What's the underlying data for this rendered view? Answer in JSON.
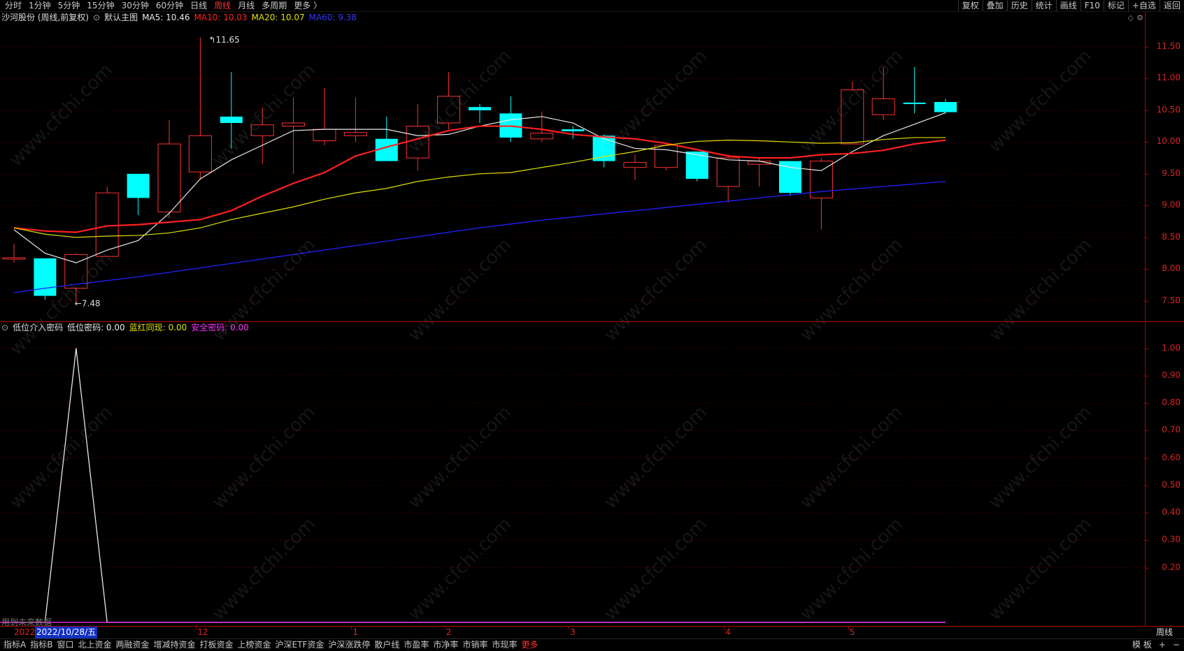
{
  "toolbar": {
    "periods": [
      "分时",
      "1分钟",
      "5分钟",
      "15分钟",
      "30分钟",
      "60分钟",
      "日线",
      "周线",
      "月线",
      "多周期",
      "更多 〉"
    ],
    "active_period": "周线",
    "right_buttons": [
      "复权",
      "叠加",
      "历史",
      "统计",
      "画线",
      "F10",
      "标记",
      "+自选",
      "返回"
    ]
  },
  "main": {
    "stock_name": "沙河股份 (周线,前复权)",
    "template": "默认主图",
    "ma5": "MA5: 10.46",
    "ma10": "MA10: 10.03",
    "ma20": "MA20: 10.07",
    "ma60": "MA60: 9.38",
    "high_label": "11.65",
    "low_label": "7.48",
    "axis_ticks": [
      "11.50",
      "11.00",
      "10.50",
      "10.00",
      "9.50",
      "9.00",
      "8.50",
      "8.00",
      "7.50"
    ]
  },
  "indicator": {
    "name": "低位介入密码",
    "v1": "低位密码: 0.00",
    "v2": "蓝红同现: 0.00",
    "v3": "安全密码: 0.00",
    "axis_ticks": [
      "1.00",
      "0.90",
      "0.80",
      "0.70",
      "0.60",
      "0.50",
      "0.40",
      "0.30",
      "0.20"
    ],
    "future_note": "用到未来数据"
  },
  "time_axis": {
    "year_marker": "2022",
    "cursor_date": "2022/10/28/五",
    "months": [
      "12",
      "1",
      "2",
      "3",
      "4",
      "5"
    ],
    "period_label": "周线"
  },
  "bottom": {
    "buttons": [
      "指标A",
      "指标B",
      "窗口",
      "北上资金",
      "两融资金",
      "增减持资金",
      "打板资金",
      "上榜资金",
      "沪深ETF资金",
      "沪深涨跌停",
      "散户线",
      "市盈率",
      "市净率",
      "市销率",
      "市现率",
      "更多"
    ],
    "right": [
      "模 板",
      "+",
      "−"
    ]
  },
  "watermark": "www.cfchi.com",
  "colors": {
    "up": "#ff3232",
    "down": "#00ffff",
    "ma5": "#e8e8e8",
    "ma10": "#ff2020",
    "ma20": "#e0e000",
    "ma60": "#2020ff"
  },
  "chart_data": {
    "type": "candlestick",
    "candles": [
      {
        "o": 8.18,
        "h": 8.4,
        "l": 8.1,
        "c": 8.18
      },
      {
        "o": 8.17,
        "h": 8.17,
        "l": 7.52,
        "c": 7.58
      },
      {
        "o": 7.7,
        "h": 8.25,
        "l": 7.48,
        "c": 8.23
      },
      {
        "o": 8.2,
        "h": 9.3,
        "l": 8.2,
        "c": 9.2
      },
      {
        "o": 9.5,
        "h": 9.5,
        "l": 8.85,
        "c": 9.12
      },
      {
        "o": 8.9,
        "h": 10.35,
        "l": 8.8,
        "c": 9.97
      },
      {
        "o": 9.53,
        "h": 11.65,
        "l": 9.4,
        "c": 10.1
      },
      {
        "o": 10.4,
        "h": 11.1,
        "l": 9.9,
        "c": 10.3
      },
      {
        "o": 10.1,
        "h": 10.55,
        "l": 9.65,
        "c": 10.27
      },
      {
        "o": 10.25,
        "h": 10.7,
        "l": 9.5,
        "c": 10.3
      },
      {
        "o": 10.02,
        "h": 10.85,
        "l": 9.95,
        "c": 10.2
      },
      {
        "o": 10.1,
        "h": 10.7,
        "l": 10.0,
        "c": 10.15
      },
      {
        "o": 10.05,
        "h": 10.4,
        "l": 9.8,
        "c": 9.7
      },
      {
        "o": 9.75,
        "h": 10.6,
        "l": 9.55,
        "c": 10.25
      },
      {
        "o": 10.3,
        "h": 11.1,
        "l": 10.2,
        "c": 10.72
      },
      {
        "o": 10.55,
        "h": 10.6,
        "l": 10.3,
        "c": 10.5
      },
      {
        "o": 10.45,
        "h": 10.72,
        "l": 10.0,
        "c": 10.07
      },
      {
        "o": 10.05,
        "h": 10.48,
        "l": 10.0,
        "c": 10.14
      },
      {
        "o": 10.2,
        "h": 10.25,
        "l": 10.05,
        "c": 10.17
      },
      {
        "o": 10.1,
        "h": 10.12,
        "l": 9.6,
        "c": 9.7
      },
      {
        "o": 9.6,
        "h": 9.8,
        "l": 9.4,
        "c": 9.68
      },
      {
        "o": 9.6,
        "h": 9.98,
        "l": 9.55,
        "c": 9.95
      },
      {
        "o": 9.85,
        "h": 9.85,
        "l": 9.38,
        "c": 9.42
      },
      {
        "o": 9.3,
        "h": 9.8,
        "l": 9.05,
        "c": 9.75
      },
      {
        "o": 9.65,
        "h": 9.75,
        "l": 9.3,
        "c": 9.7
      },
      {
        "o": 9.7,
        "h": 9.7,
        "l": 9.15,
        "c": 9.2
      },
      {
        "o": 9.12,
        "h": 9.75,
        "l": 8.62,
        "c": 9.7
      },
      {
        "o": 9.97,
        "h": 10.95,
        "l": 9.97,
        "c": 10.82
      },
      {
        "o": 10.43,
        "h": 11.18,
        "l": 10.35,
        "c": 10.68
      },
      {
        "o": 10.62,
        "h": 11.18,
        "l": 10.45,
        "c": 10.6
      },
      {
        "o": 10.63,
        "h": 10.68,
        "l": 10.45,
        "c": 10.47
      }
    ],
    "ma5": [
      8.62,
      8.25,
      8.1,
      8.3,
      8.45,
      8.88,
      9.42,
      9.72,
      9.95,
      10.18,
      10.2,
      10.2,
      10.2,
      10.1,
      10.12,
      10.25,
      10.35,
      10.4,
      10.3,
      10.05,
      9.9,
      9.88,
      9.8,
      9.72,
      9.7,
      9.6,
      9.55,
      9.85,
      10.1,
      10.28,
      10.46
    ],
    "ma10": [
      8.65,
      8.6,
      8.58,
      8.68,
      8.7,
      8.74,
      8.78,
      8.92,
      9.15,
      9.35,
      9.52,
      9.78,
      9.92,
      10.05,
      10.18,
      10.25,
      10.25,
      10.2,
      10.12,
      10.08,
      10.05,
      9.98,
      9.88,
      9.78,
      9.75,
      9.75,
      9.8,
      9.82,
      9.87,
      9.97,
      10.03
    ],
    "ma20": [
      8.65,
      8.55,
      8.5,
      8.52,
      8.53,
      8.57,
      8.65,
      8.78,
      8.88,
      8.98,
      9.1,
      9.2,
      9.27,
      9.38,
      9.45,
      9.5,
      9.52,
      9.6,
      9.68,
      9.77,
      9.85,
      9.95,
      10.01,
      10.03,
      10.02,
      10.0,
      9.98,
      9.99,
      10.04,
      10.07,
      10.07
    ],
    "ma60": [
      7.63,
      7.7,
      7.76,
      7.82,
      7.88,
      7.95,
      8.02,
      8.09,
      8.16,
      8.23,
      8.3,
      8.37,
      8.44,
      8.51,
      8.58,
      8.65,
      8.71,
      8.77,
      8.82,
      8.87,
      8.92,
      8.97,
      9.02,
      9.07,
      9.12,
      9.17,
      9.22,
      9.26,
      9.3,
      9.34,
      9.38
    ],
    "indicator_series": [
      0,
      0,
      1,
      0,
      0,
      0,
      0,
      0,
      0,
      0,
      0,
      0,
      0,
      0,
      0,
      0,
      0,
      0,
      0,
      0,
      0,
      0,
      0,
      0,
      0,
      0,
      0,
      0,
      0,
      0,
      0
    ],
    "ylim_price": [
      7.3,
      11.85
    ],
    "ylim_indicator": [
      0,
      1.05
    ]
  }
}
